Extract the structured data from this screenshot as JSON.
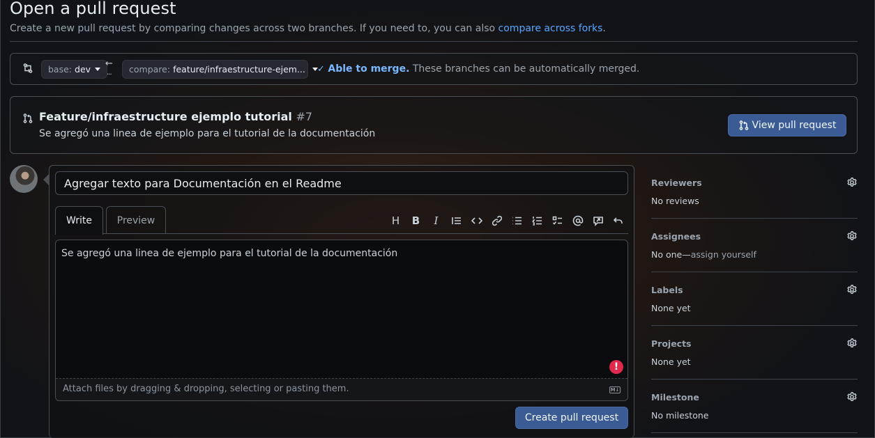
{
  "page": {
    "title": "Open a pull request",
    "subtitle": "Create a new pull request by comparing changes across two branches. If you need to, you can also",
    "subtitle_link": "compare across forks",
    "subtitle_end": "."
  },
  "range": {
    "base_label": "base:",
    "base_value": "dev",
    "compare_label": "compare:",
    "compare_value": "feature/infraestructure-ejem...",
    "merge_ok": "Able to merge.",
    "merge_text": "These branches can be automatically merged."
  },
  "existing_pr": {
    "title": "Feature/infraestructure ejemplo tutorial",
    "number": "#7",
    "description": "Se agregó una linea de ejemplo para el tutorial de la documentación",
    "view_button": "View pull request"
  },
  "editor": {
    "title_value": "Agregar texto para Documentación en el Readme",
    "tab_write": "Write",
    "tab_preview": "Preview",
    "toolbar_icons": [
      "heading-icon",
      "bold-icon",
      "italic-icon",
      "quote-icon",
      "code-icon",
      "link-icon",
      "unordered-list-icon",
      "ordered-list-icon",
      "task-list-icon",
      "mention-icon",
      "reference-icon",
      "undo-icon"
    ],
    "body": "Se agregó una linea de ejemplo para el tutorial de la documentación",
    "warning_glyph": "!",
    "attach_hint": "Attach files by dragging & dropping, selecting or pasting them.",
    "markdown_badge": "M↓",
    "submit": "Create pull request"
  },
  "sidebar": {
    "reviewers": {
      "label": "Reviewers",
      "value": "No reviews"
    },
    "assignees": {
      "label": "Assignees",
      "value_prefix": "No one—",
      "value_link": "assign yourself"
    },
    "labels": {
      "label": "Labels",
      "value": "None yet"
    },
    "projects": {
      "label": "Projects",
      "value": "None yet"
    },
    "milestone": {
      "label": "Milestone",
      "value": "No milestone"
    }
  },
  "colors": {
    "accent_link": "#58a6ff",
    "primary_button": "#3b5b94",
    "warning": "#e0294d"
  }
}
